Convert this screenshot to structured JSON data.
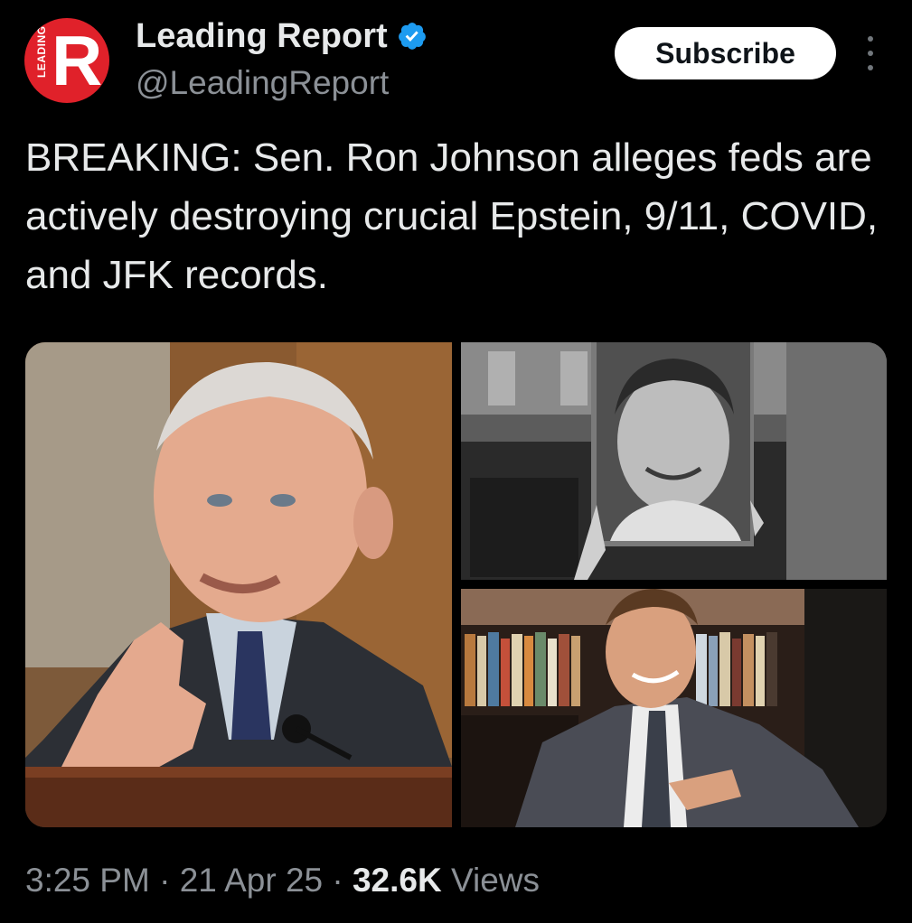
{
  "account": {
    "display_name": "Leading Report",
    "handle": "@LeadingReport",
    "avatar_letter": "R",
    "avatar_side_text": "LEADING",
    "avatar_color": "#e0212a",
    "verified_color": "#1d9bf0"
  },
  "actions": {
    "subscribe_label": "Subscribe",
    "more_icon": "more-vertical-icon"
  },
  "tweet": {
    "text": "BREAKING: Sen. Ron Johnson alleges feds are actively destroying crucial Epstein, 9/11, COVID, and JFK records."
  },
  "media": {
    "photos": [
      "senator-speaking-photo",
      "epstein-poster-photo",
      "jfk-portrait-photo"
    ]
  },
  "meta": {
    "time": "3:25 PM",
    "sep1": " · ",
    "date": "21 Apr 25",
    "sep2": " · ",
    "views_count": "32.6K",
    "views_label": " Views"
  }
}
